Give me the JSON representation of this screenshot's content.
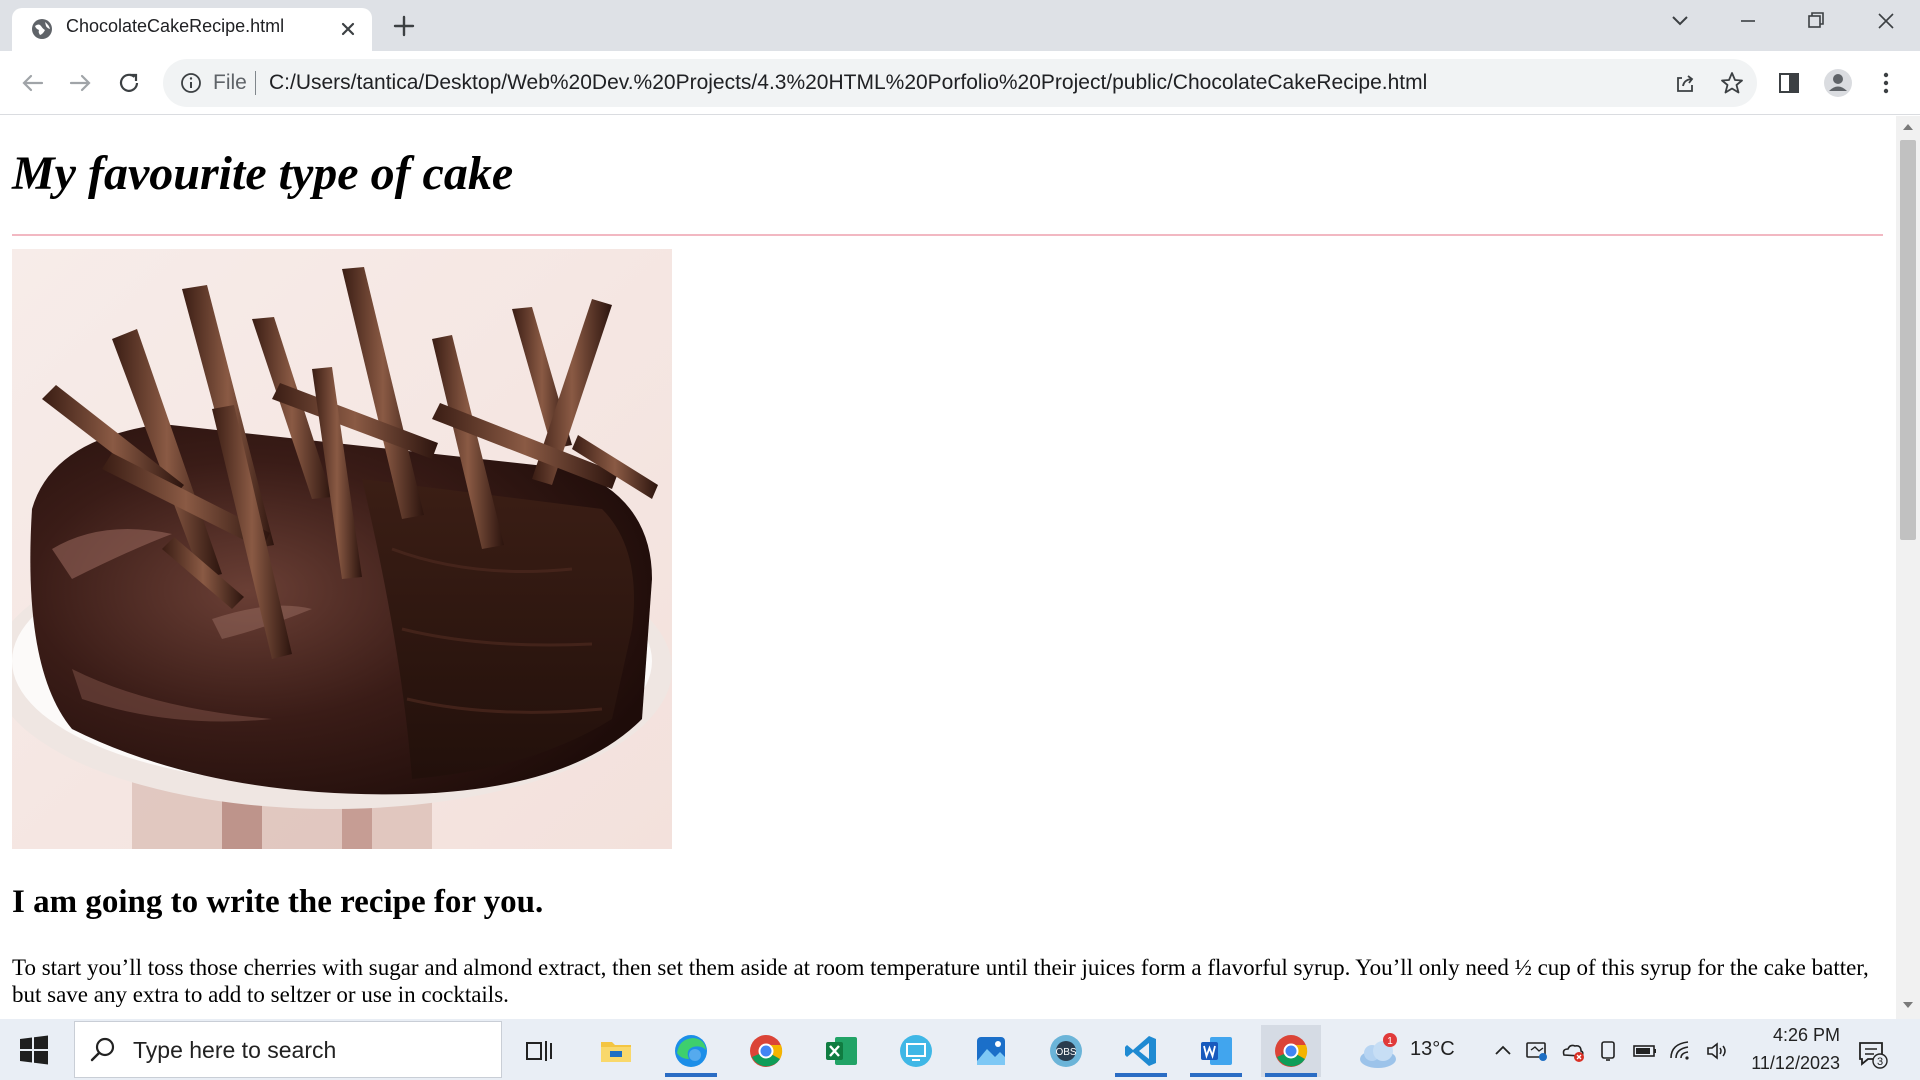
{
  "browser": {
    "tab_title": "ChocolateCakeRecipe.html",
    "omnibox_scheme": "File",
    "url": "C:/Users/tantica/Desktop/Web%20Dev.%20Projects/4.3%20HTML%20Porfolio%20Project/public/ChocolateCakeRecipe.html",
    "icons": {
      "favicon": "globe-icon",
      "close_tab": "close-icon",
      "new_tab": "plus-icon",
      "back": "arrow-left-icon",
      "forward": "arrow-right-icon",
      "reload": "reload-icon",
      "site_info": "info-icon",
      "share": "share-icon",
      "bookmark": "star-icon",
      "side_panel": "side-panel-icon",
      "profile": "profile-icon",
      "menu": "kebab-menu-icon"
    }
  },
  "page": {
    "heading": "My favourite type of cake",
    "image_alt": "chocolate cake with chocolate curls",
    "subheading": "I am going to write the recipe for you.",
    "paragraph": "To start you’ll toss those cherries with sugar and almond extract, then set them aside at room temperature until their juices form a flavorful syrup. You’ll only need ½ cup of this syrup for the cake batter, but save any extra to add to seltzer or use in cocktails.",
    "rule_color": "#f2b8c2"
  },
  "taskbar": {
    "search_placeholder": "Type here to search",
    "apps": [
      "task-view-icon",
      "file-explorer-icon",
      "edge-icon",
      "chrome-icon",
      "excel-icon",
      "remote-desktop-icon",
      "photos-icon",
      "obs-icon",
      "vscode-icon",
      "word-icon",
      "chrome-icon"
    ],
    "weather_temp": "13°C",
    "weather_badge": "1",
    "time": "4:26 PM",
    "date": "11/12/2023",
    "notification_count": "3"
  }
}
